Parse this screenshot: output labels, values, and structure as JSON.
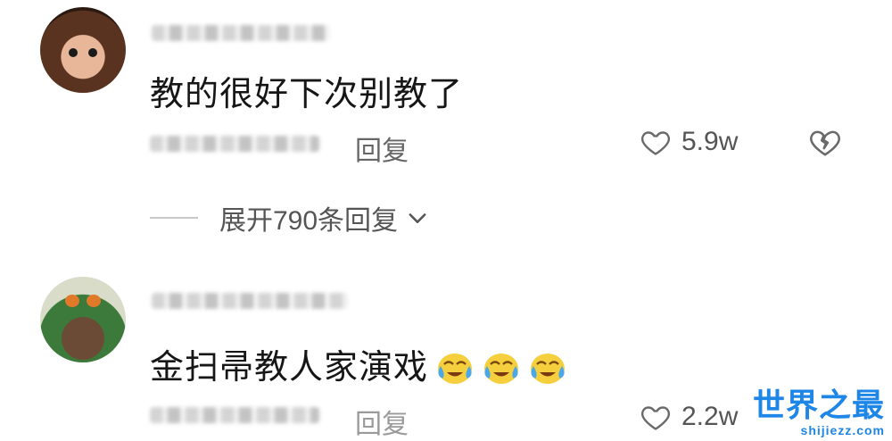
{
  "comments": [
    {
      "text": "教的很好下次别教了",
      "reply_label": "回复",
      "like_count": "5.9w",
      "expand_label": "展开790条回复"
    },
    {
      "text": "金扫帚教人家演戏",
      "reply_label": "回复",
      "like_count": "2.2w"
    }
  ],
  "watermark": {
    "main": "世界之最",
    "sub": "shijiezz.com"
  },
  "icons": [
    "heart-outline-icon",
    "broken-heart-icon",
    "chevron-down-icon",
    "crying-laughing-emoji-icon"
  ]
}
